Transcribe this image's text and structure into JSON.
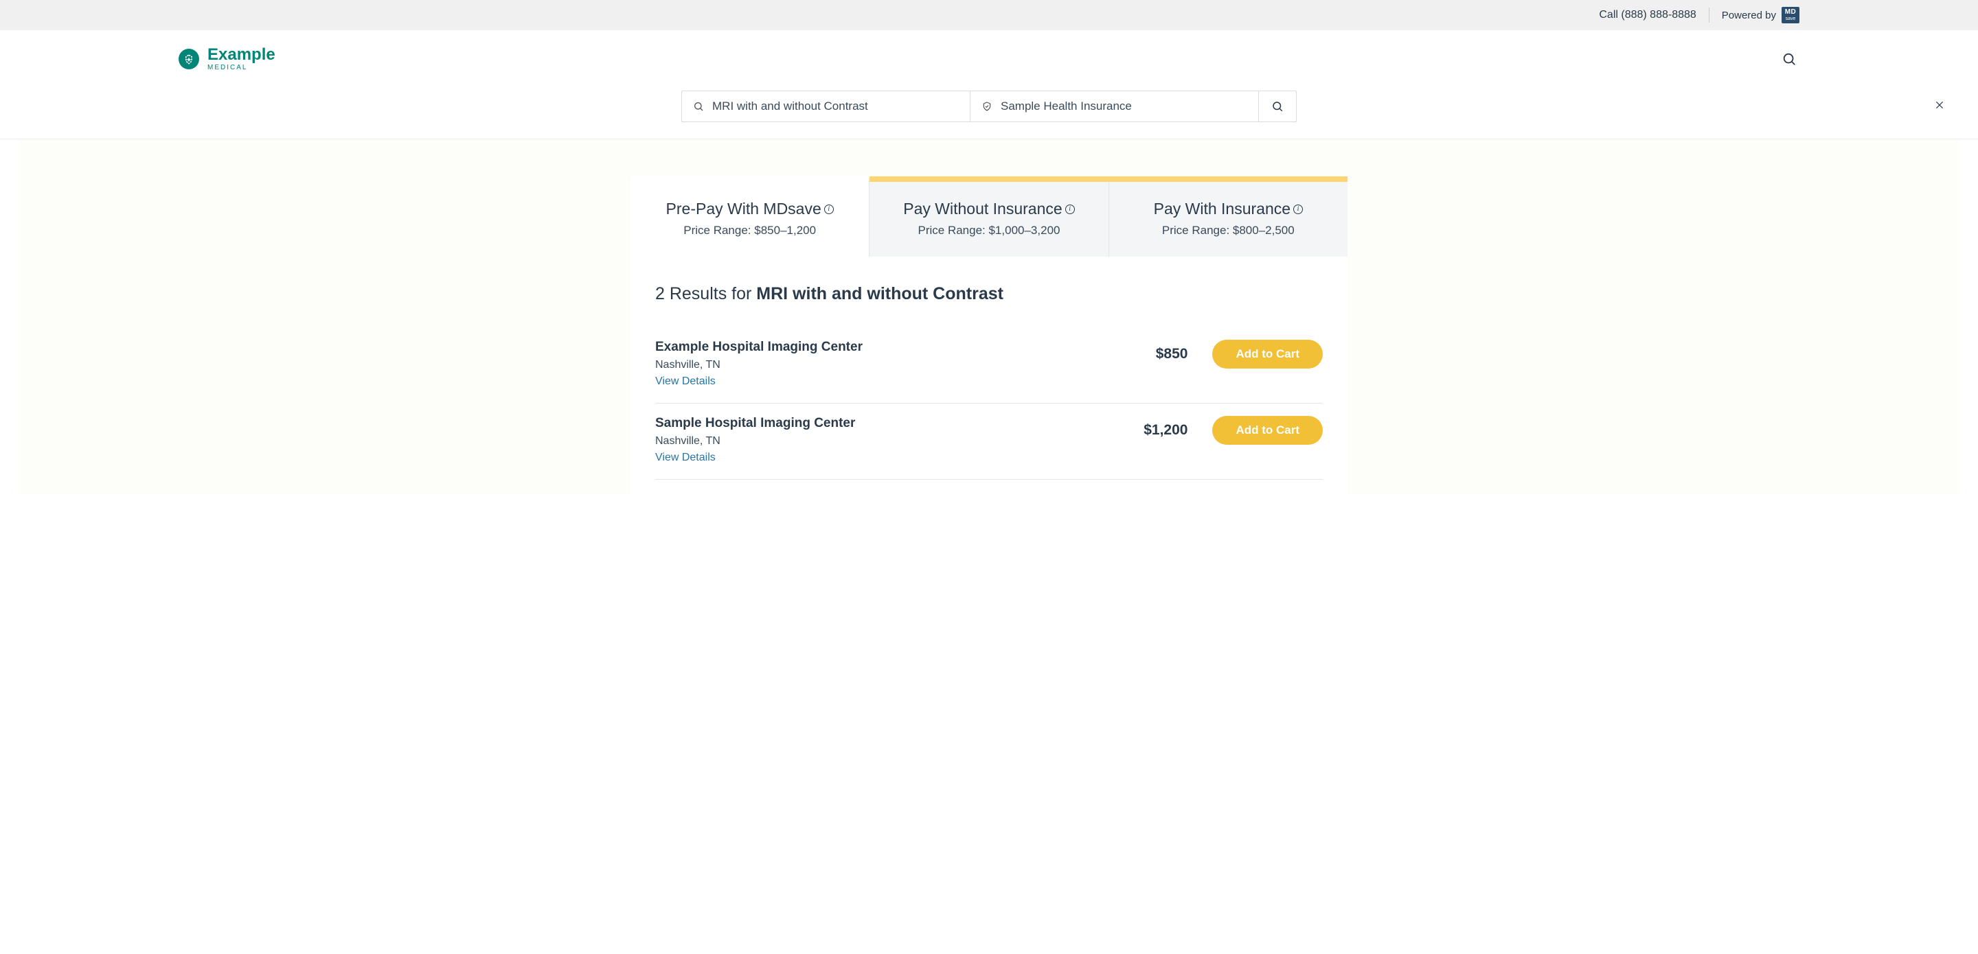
{
  "topbar": {
    "call_text": "Call (888) 888-8888",
    "powered_by": "Powered by",
    "mdsave_top": "MD",
    "mdsave_bot": "save"
  },
  "logo": {
    "name": "Example",
    "sub": "MEDICAL"
  },
  "search": {
    "procedure_value": "MRI with and without Contrast",
    "insurance_value": "Sample Health Insurance"
  },
  "tabs": [
    {
      "title": "Pre-Pay With MDsave",
      "range": "Price Range: $850–1,200",
      "active": true
    },
    {
      "title": "Pay Without Insurance",
      "range": "Price Range: $1,000–3,200",
      "active": false
    },
    {
      "title": "Pay With Insurance",
      "range": "Price Range: $800–2,500",
      "active": false
    }
  ],
  "results_heading": {
    "prefix": "2 Results for ",
    "query": "MRI with and without Contrast"
  },
  "results": [
    {
      "name": "Example Hospital Imaging Center",
      "location": "Nashville, TN",
      "details_label": "View Details",
      "price": "$850",
      "cta": "Add to Cart"
    },
    {
      "name": "Sample Hospital Imaging Center",
      "location": "Nashville, TN",
      "details_label": "View Details",
      "price": "$1,200",
      "cta": "Add to Cart"
    }
  ]
}
